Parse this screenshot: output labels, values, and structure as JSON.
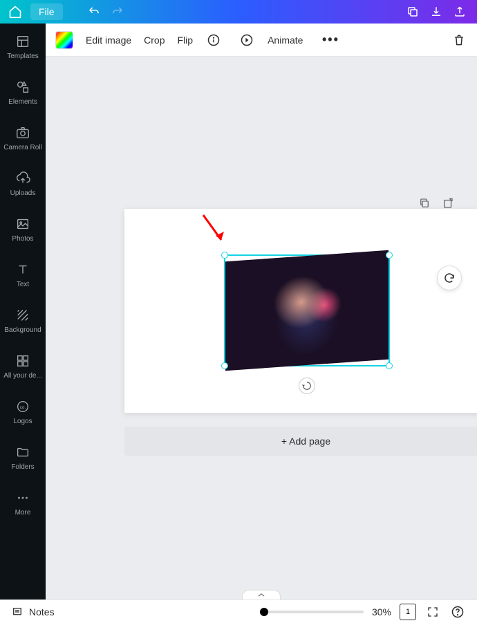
{
  "header": {
    "file_label": "File"
  },
  "sidebar": {
    "items": [
      {
        "label": "Templates",
        "icon": "templates-icon"
      },
      {
        "label": "Elements",
        "icon": "elements-icon"
      },
      {
        "label": "Camera Roll",
        "icon": "camera-icon"
      },
      {
        "label": "Uploads",
        "icon": "uploads-icon"
      },
      {
        "label": "Photos",
        "icon": "photos-icon"
      },
      {
        "label": "Text",
        "icon": "text-icon"
      },
      {
        "label": "Background",
        "icon": "background-icon"
      },
      {
        "label": "All your de...",
        "icon": "designs-icon"
      },
      {
        "label": "Logos",
        "icon": "logos-icon"
      },
      {
        "label": "Folders",
        "icon": "folders-icon"
      },
      {
        "label": "More",
        "icon": "more-icon"
      }
    ]
  },
  "toolbar": {
    "edit_image_label": "Edit image",
    "crop_label": "Crop",
    "flip_label": "Flip",
    "animate_label": "Animate"
  },
  "canvas": {
    "add_page_label": "+ Add page",
    "selected_image": {
      "selected": true,
      "rotation_deg": -4
    }
  },
  "footer": {
    "notes_label": "Notes",
    "zoom_percent_label": "30%",
    "zoom_value": 30,
    "page_indicator": "1"
  },
  "colors": {
    "accent_cyan": "#13d3e3",
    "header_gradient_start": "#00c4cc",
    "header_gradient_mid": "#2b5dff",
    "header_gradient_end": "#7d2ae8",
    "sidebar_bg": "#0d1216"
  }
}
